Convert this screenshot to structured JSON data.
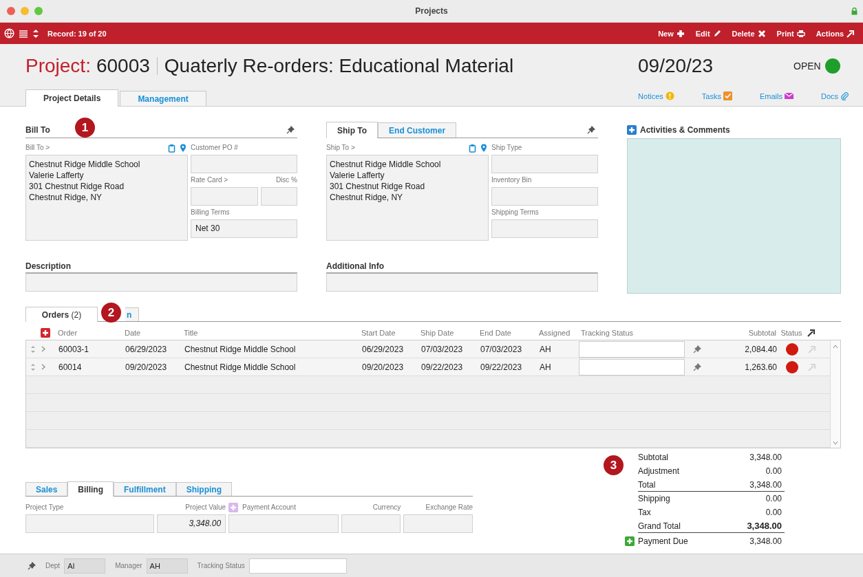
{
  "window": {
    "title": "Projects"
  },
  "toolbar": {
    "record": "Record: 19 of 20",
    "actions": [
      {
        "label": "New",
        "kind": "plus"
      },
      {
        "label": "Edit",
        "kind": "pencil"
      },
      {
        "label": "Delete",
        "kind": "cross"
      },
      {
        "label": "Print",
        "kind": "printer"
      },
      {
        "label": "Actions",
        "kind": "arrow"
      }
    ]
  },
  "header": {
    "prefix": "Project:",
    "number": "60003",
    "title": "Quaterly Re-orders: Educational Material",
    "date": "09/20/23",
    "status": "OPEN",
    "color": "#1e9e2a"
  },
  "tabs": [
    {
      "label": "Project Details",
      "selected": true
    },
    {
      "label": "Management",
      "selected": false
    }
  ],
  "links": [
    {
      "label": "Notices",
      "kind": "alert"
    },
    {
      "label": "Tasks",
      "kind": "check"
    },
    {
      "label": "Emails",
      "kind": "mail"
    },
    {
      "label": "Docs",
      "kind": "clip"
    }
  ],
  "bill_to": {
    "heading": "Bill To",
    "badge": "1",
    "address_label": "Bill To >",
    "address": "Chestnut Ridge Middle School\nValerie Lafferty\n301 Chestnut Ridge Road\nChestnut Ridge, NY",
    "rows": [
      [
        {
          "label": "Customer PO #"
        }
      ],
      [
        {
          "label": "Rate Card >"
        },
        {
          "label": "Disc %"
        }
      ],
      [
        {
          "label": "Billing Terms",
          "value": "Net 30"
        }
      ]
    ]
  },
  "ship_to": {
    "tabs": [
      {
        "label": "Ship To",
        "selected": true
      },
      {
        "label": "End Customer",
        "selected": false
      }
    ],
    "address_label": "Ship To >",
    "address": "Chestnut Ridge Middle School\nValerie Lafferty\n301 Chestnut Ridge Road\nChestnut Ridge, NY",
    "rows": [
      [
        {
          "label": "Ship Type"
        }
      ],
      [
        {
          "label": "Inventory Bin"
        }
      ],
      [
        {
          "label": "Shipping Terms"
        }
      ]
    ]
  },
  "description": {
    "heading": "Description"
  },
  "additional_info": {
    "heading": "Additional Info"
  },
  "activities": {
    "heading": "Activities & Comments"
  },
  "orders": {
    "tabs": [
      {
        "label": "Orders",
        "count": "(2)",
        "selected": true
      },
      {
        "label": "n",
        "selected": false
      }
    ],
    "badge": "2",
    "columns": [
      "Order",
      "Date",
      "Title",
      "Start Date",
      "Ship Date",
      "End Date",
      "Assigned",
      "Tracking Status",
      "Subtotal",
      "Status"
    ],
    "rows": [
      {
        "order": "60003-1",
        "date": "06/29/2023",
        "title": "Chestnut Ridge Middle School",
        "start": "06/29/2023",
        "ship": "07/03/2023",
        "end": "07/03/2023",
        "assigned": "AH",
        "subtotal": "2,084.40",
        "color": "#d01a10"
      },
      {
        "order": "60014",
        "date": "09/20/2023",
        "title": "Chestnut Ridge Middle School",
        "start": "09/20/2023",
        "ship": "09/22/2023",
        "end": "09/22/2023",
        "assigned": "AH",
        "subtotal": "1,263.60",
        "color": "#d01a10"
      }
    ]
  },
  "billing": {
    "tabs": [
      {
        "label": "Sales",
        "selected": false
      },
      {
        "label": "Billing",
        "selected": true
      },
      {
        "label": "Fulfillment",
        "selected": false
      },
      {
        "label": "Shipping",
        "selected": false
      }
    ],
    "fields": [
      {
        "label": "Project Type"
      },
      {
        "label": "Project Value",
        "value": "3,348.00"
      },
      {
        "label": "Payment Account",
        "kind": "addable"
      },
      {
        "label": "Currency"
      },
      {
        "label": "Exchange Rate"
      }
    ]
  },
  "totals": {
    "badge": "3",
    "lines": [
      {
        "label": "Subtotal",
        "value": "3,348.00",
        "kind": "plain"
      },
      {
        "label": "Adjustment",
        "value": "0.00",
        "kind": "plain"
      },
      {
        "label": "Total",
        "value": "3,348.00",
        "kind": "ruled"
      },
      {
        "label": "Shipping",
        "value": "0.00",
        "kind": "plain"
      },
      {
        "label": "Tax",
        "value": "0.00",
        "kind": "plain"
      },
      {
        "label": "Grand Total",
        "value": "3,348.00",
        "kind": "grand"
      },
      {
        "label": "Payment Due",
        "value": "3,348.00",
        "kind": "due"
      }
    ]
  },
  "footer": {
    "fields": [
      {
        "label": "Dept",
        "value": "AI"
      },
      {
        "label": "Manager",
        "value": "AH"
      },
      {
        "label": "Tracking Status",
        "kind": "white"
      }
    ]
  }
}
